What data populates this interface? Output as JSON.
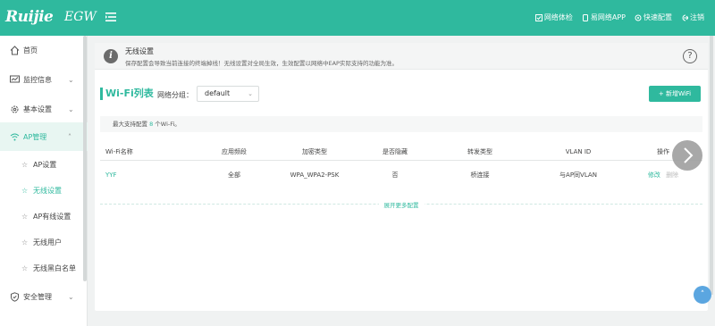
{
  "header": {
    "logo": "Ruijie",
    "product": "EGW",
    "actions": [
      {
        "label": "网络体检",
        "icon": "network-check-icon"
      },
      {
        "label": "易网络APP",
        "icon": "app-icon"
      },
      {
        "label": "快速配置",
        "icon": "quick-config-icon"
      },
      {
        "label": "注销",
        "icon": "logout-icon"
      }
    ]
  },
  "sidebar": {
    "items": [
      {
        "label": "首页",
        "icon": "home-icon"
      },
      {
        "label": "监控信息",
        "icon": "monitor-icon"
      },
      {
        "label": "基本设置",
        "icon": "gear-icon"
      },
      {
        "label": "AP管理",
        "icon": "wifi-icon"
      },
      {
        "label": "安全管理",
        "icon": "shield-icon"
      }
    ],
    "sub_items": [
      {
        "label": "AP设置"
      },
      {
        "label": "无线设置"
      },
      {
        "label": "AP有线设置"
      },
      {
        "label": "无线用户"
      },
      {
        "label": "无线黑白名单"
      }
    ]
  },
  "banner": {
    "title": "无线设置",
    "description": "保存配置会导致当前连接的终端掉线！无线设置对全局生效，生效配置以网络中EAP实际支持的功能为准。",
    "help_symbol": "?",
    "info_symbol": "i"
  },
  "wifi": {
    "section_title": "Wi-Fi列表",
    "group_label": "网络分组：",
    "group_value": "default",
    "add_button": "+ 新增WiFi",
    "max_prefix": "最大支持配置",
    "max_count": "8",
    "max_suffix": "个Wi-Fi。",
    "columns": [
      "Wi-Fi名称",
      "应用频段",
      "加密类型",
      "是否隐藏",
      "转发类型",
      "VLAN ID",
      "操作"
    ],
    "rows": [
      {
        "name": "YYF",
        "band": "全部",
        "encryption": "WPA_WPA2-PSK",
        "hidden": "否",
        "forwarding": "桥连接",
        "vlan": "与AP同VLAN",
        "edit": "修改",
        "delete": "删除"
      }
    ],
    "expand_text": "展开更多配置"
  },
  "colors": {
    "accent": "#2fb99e",
    "header_bg": "#2fb99e",
    "page_bg": "#f0f2f2"
  }
}
